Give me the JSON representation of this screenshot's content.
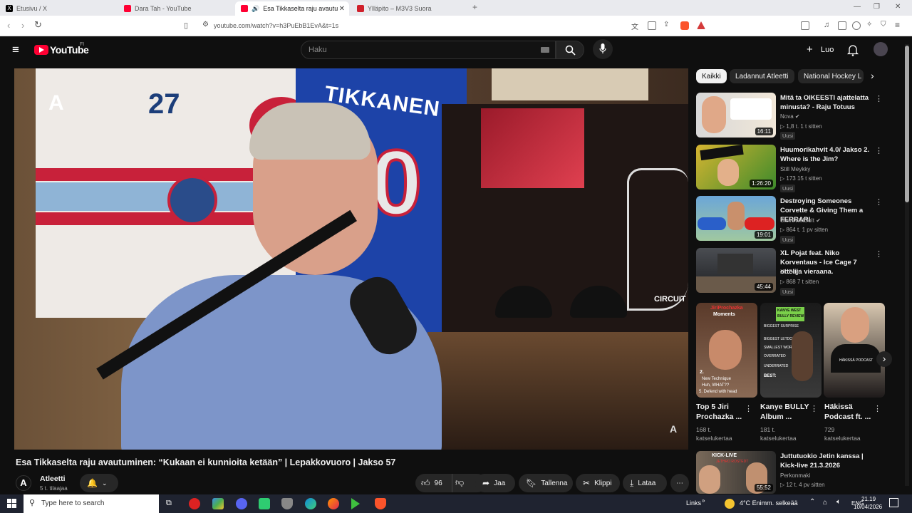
{
  "browser": {
    "tabs": [
      {
        "label": "Etusivu / X",
        "color": "#000000"
      },
      {
        "label": "Dara Tah - YouTube",
        "color": "#ff0033"
      },
      {
        "label": "Esa Tikkaselta raju avautuminen",
        "color": "#ff0033"
      },
      {
        "label": "Ylläpito – M3V3 Suora",
        "color": "#d0202b"
      }
    ],
    "url": "youtube.com/watch?v=h3PuEbB1EvA&t=1s"
  },
  "yt": {
    "logo": "YouTube",
    "region": "FI",
    "search_placeholder": "Haku",
    "create_label": "Luo"
  },
  "video": {
    "title": "Esa Tikkaselta raju avautuminen: “Kukaan ei kunnioita ketään” | Lepakkovuoro | Jakso 57",
    "channel": "Atleetti",
    "subs": "5 t. tilaajaa",
    "likes": "96",
    "share": "Jaa",
    "save": "Tallenna",
    "clip": "Klippi",
    "download": "Lataa",
    "jersey_number": "27",
    "jersey_name": "TIKKANEN",
    "jersey_digit": "0",
    "sign": "CIRCUIT"
  },
  "chips": [
    {
      "label": "Kaikki"
    },
    {
      "label": "Ladannut Atleetti"
    },
    {
      "label": "National Hockey L"
    }
  ],
  "recs": [
    {
      "title": "Mitä ta OIKEESTI ajattelatta minusta? - Raju Totuus",
      "channel": "Nova ✔",
      "meta": "▷ 1,8 t.   1 t sitten",
      "badge": "Uusi",
      "duration": "16:11",
      "c1": "#d8d8d8",
      "c2": "#f1e7d8"
    },
    {
      "title": "Huumorikahvit 4.0/ Jakso 2. Where is the Jim?",
      "channel": "Still Meykky",
      "meta": "▷ 173   15 t sitten",
      "badge": "Uusi",
      "duration": "1:26:20",
      "c1": "#d6b531",
      "c2": "#3d8a2b"
    },
    {
      "title": "Destroying Someones Corvette & Giving Them a FERRARI",
      "channel": "SteveWillDoIt ✔",
      "meta": "▷ 864 t.   1 pv sitten",
      "badge": "Uusi",
      "duration": "19:01",
      "c1": "#3c7fbf",
      "c2": "#cfe0ea"
    },
    {
      "title": "XL Pojat feat. Niko Korventaus - Ice Cage 7 ottelija vieraana.",
      "channel": "XL Pojat",
      "meta": "▷ 868   7 t sitten",
      "badge": "Uusi",
      "duration": "45:44",
      "c1": "#4a4d52",
      "c2": "#1e1f22"
    },
    {
      "title": "Juttutuokio Jetin kanssa | Kick-live 21.3.2026",
      "channel": "Perkonmaki",
      "meta": "▷ 12 t.   4 pv sitten",
      "badge": "",
      "duration": "55:52",
      "c1": "#7a6a5a",
      "c2": "#2a2a2a"
    }
  ],
  "shorts": [
    {
      "title1": "Top 5 Jiri",
      "title2": "Prochazka ...",
      "views1": "168 t.",
      "views2": "katselukertaa",
      "c1": "#5a3a2a",
      "c2": "#8a6a55"
    },
    {
      "title1": "Kanye BULLY",
      "title2": "Album ...",
      "views1": "181 t.",
      "views2": "katselukertaa",
      "c1": "#1a1a1a",
      "c2": "#3a3a3a"
    },
    {
      "title1": "Häkissä",
      "title2": "Podcast ft. ...",
      "views1": "729",
      "views2": "katselukertaa",
      "c1": "#d8c7b0",
      "c2": "#1e1a1a"
    }
  ],
  "shorts_text": {
    "s1_top": "JiriProchazka",
    "s1_sub": "Moments",
    "s1_n": "2.",
    "s1_l1": "New Technique",
    "s1_l2": "Huh, WHAT??",
    "s1_l3": "5. Defend with head",
    "s2_t1": "KANYE WEST",
    "s2_t2": "BULLY REVIEW",
    "s2_t3": "BIGGEST SURPRISE",
    "s2_t4": "BIGGEST LETDOWN",
    "s2_t5": "SMALLEST WORST",
    "s2_t6": "OVERRATED",
    "s2_t7": "UNDERRATED",
    "s2_t8": "BEST:",
    "s3_t1": "HÄKISSÄ PODCAST"
  },
  "rec5_thumb": {
    "l1": "KICK-LIVE",
    "l2": "JETHRO ROSTEDT"
  },
  "taskbar": {
    "search": "Type here to search",
    "links": "Links",
    "weather": "4°C  Enimm. selkeää",
    "lang": "ENG",
    "time": "21.19",
    "date": "10/04/2026"
  }
}
